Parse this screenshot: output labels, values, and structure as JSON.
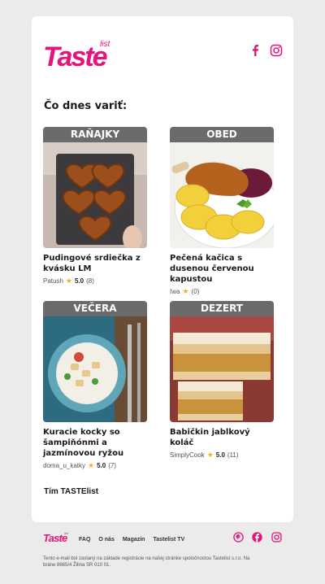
{
  "brand": {
    "logo_text": "Taste",
    "logo_sub": "list",
    "accent": "#e4147c"
  },
  "heading": "Čo dnes variť:",
  "recipes": [
    {
      "category": "RAŇAJKY",
      "title": "Pudingové srdiečka z kvásku LM",
      "author": "Patush",
      "rating": "5.0",
      "count": "(8)"
    },
    {
      "category": "OBED",
      "title": "Pečená kačica s dusenou červenou kapustou",
      "author": "Iwa",
      "rating": "",
      "count": "(0)"
    },
    {
      "category": "VEČERA",
      "title": "Kuracie kocky so šampiňónmi a jazmínovou ryžou",
      "author": "doma_u_katky",
      "rating": "5.0",
      "count": "(7)"
    },
    {
      "category": "DEZERT",
      "title": "Babičkin jablkový koláč",
      "author": "SimplyCook",
      "rating": "5.0",
      "count": "(11)"
    }
  ],
  "signoff": "Tím TASTElist",
  "footer": {
    "links": [
      "FAQ",
      "O nás",
      "Magazín",
      "Tastelist TV"
    ],
    "legal": "Tento e-mail bol zaslaný na základe registrácie na našej stránke spoločnostou Tastelist s.r.o. Na bráne 8665/4 Žilina SR 010 01."
  },
  "icons": {
    "facebook": "facebook-icon",
    "instagram": "instagram-icon",
    "pinterest": "pinterest-icon",
    "star": "star-icon"
  }
}
